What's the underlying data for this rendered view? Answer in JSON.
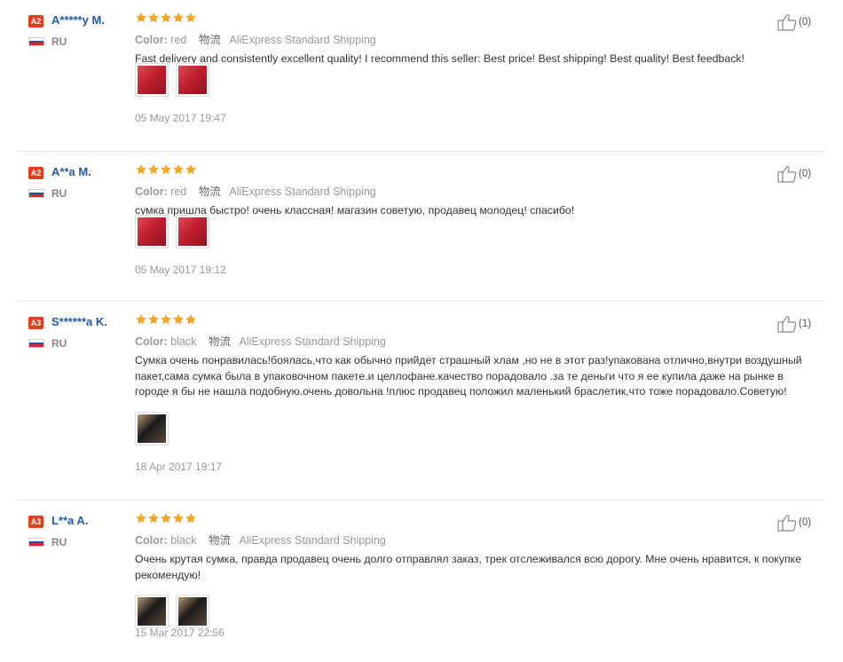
{
  "reviews": [
    {
      "level": "A2",
      "name": "A*****y M.",
      "country": "RU",
      "rating": 5,
      "color_label": "Color:",
      "color_value": "red",
      "ship_label": "物流",
      "ship_value": "AliExpress Standard Shipping",
      "text": "Fast delivery and consistently excellent quality! I recommend this seller: Best price! Best shipping! Best quality! Best feedback!",
      "photos": [
        "red-bag-photo",
        "red-bag-photo"
      ],
      "date": "05 May 2017 19:47",
      "helpful": "(0)"
    },
    {
      "level": "A2",
      "name": "A**a M.",
      "country": "RU",
      "rating": 5,
      "color_label": "Color:",
      "color_value": "red",
      "ship_label": "物流",
      "ship_value": "AliExpress Standard Shipping",
      "text": "сумка пришла быстро! очень классная! магазин советую, продавец молодец! спасибо!",
      "photos": [
        "red-bag-photo",
        "red-bag-photo"
      ],
      "date": "05 May 2017 19:12",
      "helpful": "(0)"
    },
    {
      "level": "A3",
      "name": "S******a K.",
      "country": "RU",
      "rating": 5,
      "color_label": "Color:",
      "color_value": "black",
      "ship_label": "物流",
      "ship_value": "AliExpress Standard Shipping",
      "text": "Сумка очень понравилась!боялась,что как обычно прийдет страшный хлам ,но не в этот раз!упакована отлично,внутри воздушный пакет,сама сумка была в упаковочном пакете.и целлофане.качество порадовало .за те деньги что я ее купила даже на рынке в городе я бы не нашла подобную.очень довольна !плюс продавец положил маленький браслетик,что тоже порадовало.Советую!",
      "photos": [
        "black-bag-photo"
      ],
      "date": "18 Apr 2017 19:17",
      "helpful": "(1)"
    },
    {
      "level": "A3",
      "name": "L**a A.",
      "country": "RU",
      "rating": 5,
      "color_label": "Color:",
      "color_value": "black",
      "ship_label": "物流",
      "ship_value": "AliExpress Standard Shipping",
      "text": "Очень крутая сумка, правда продавец очень долго отправлял заказ, трек отслеживался всю дорогу. Мне очень нравится, к покупке рекомендую!",
      "photos": [
        "black-bag-photo",
        "black-bag-photo"
      ],
      "date": "15 Mar 2017 22:56",
      "helpful": "(0)"
    }
  ],
  "colors": {
    "star": "#f5a623",
    "name": "#1f5aa8",
    "badge": "#e23d1c",
    "meta": "#999999"
  }
}
